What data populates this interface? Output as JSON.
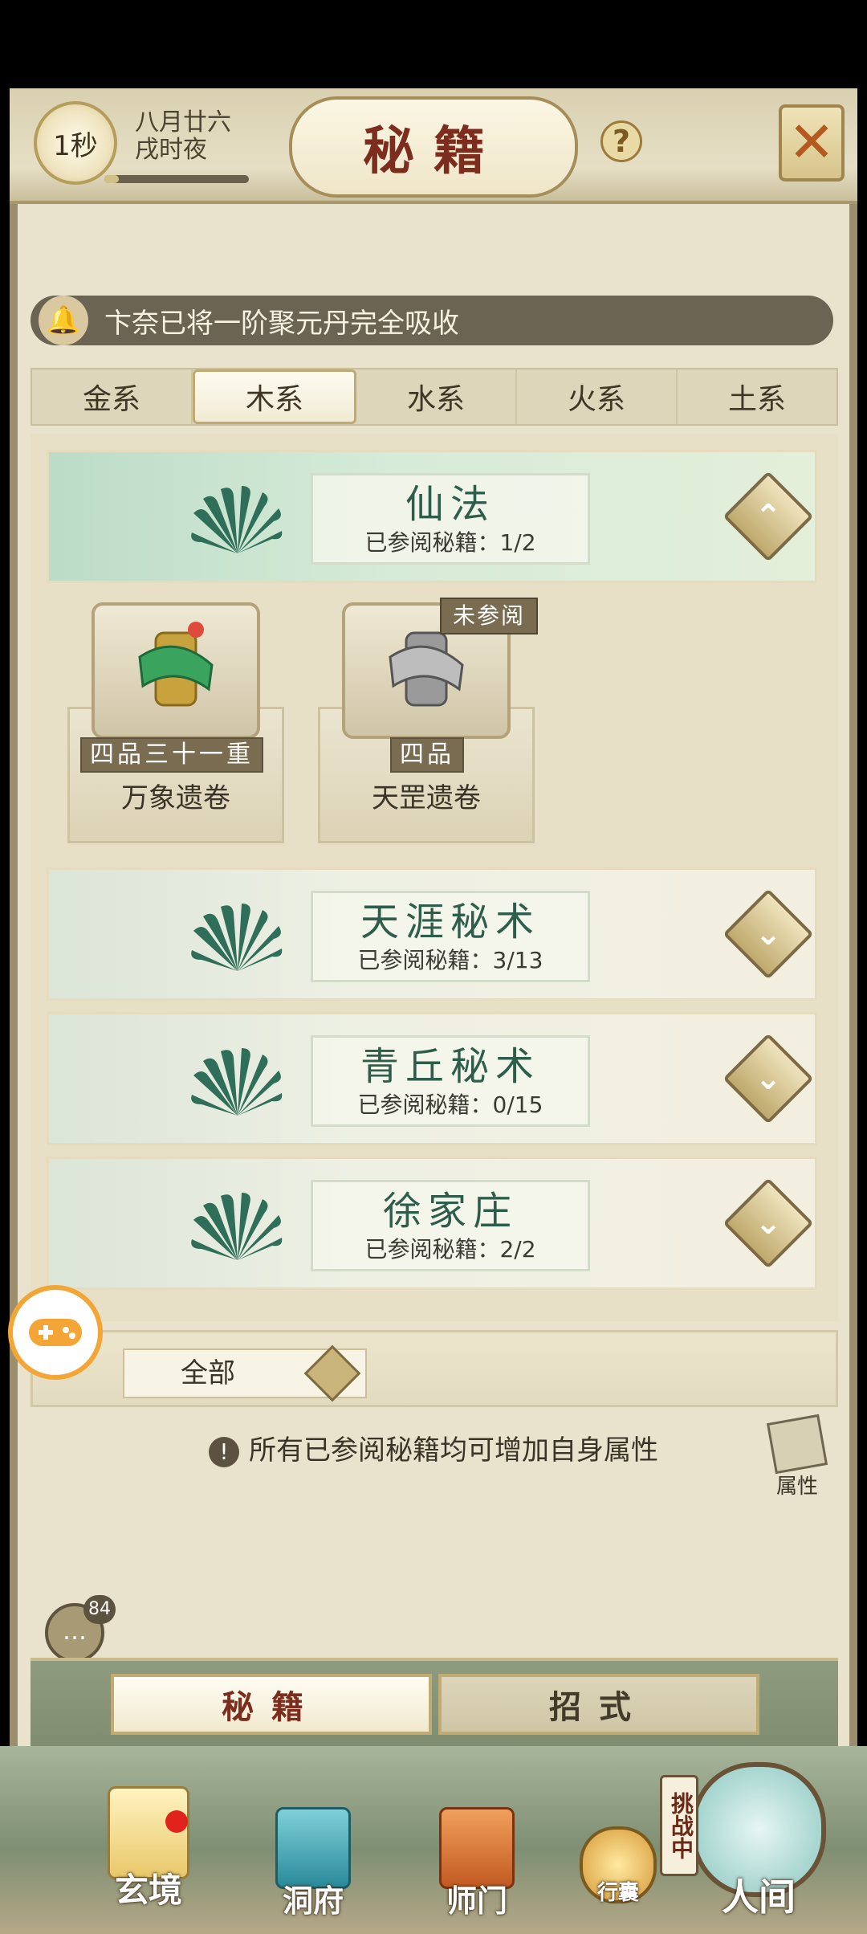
{
  "header": {
    "timer_label": "1秒",
    "date_line1": "八月廿六",
    "date_line2": "戌时夜",
    "progress_fraction": 0.1,
    "title": "秘籍",
    "help_label": "?"
  },
  "notice": {
    "text": "卞奈已将一阶聚元丹完全吸收"
  },
  "element_tabs": [
    {
      "label": "金系"
    },
    {
      "label": "木系"
    },
    {
      "label": "水系"
    },
    {
      "label": "火系"
    },
    {
      "label": "土系"
    }
  ],
  "active_tab_index": 1,
  "categories": [
    {
      "name": "仙法",
      "progress": "已参阅秘籍：1/2",
      "expanded": true
    },
    {
      "name": "天涯秘术",
      "progress": "已参阅秘籍：3/13",
      "expanded": false
    },
    {
      "name": "青丘秘术",
      "progress": "已参阅秘籍：0/15",
      "expanded": false
    },
    {
      "name": "徐家庄",
      "progress": "已参阅秘籍：2/2",
      "expanded": false
    }
  ],
  "books": [
    {
      "grade": "四品三十一重",
      "name": "万象遗卷",
      "status": ""
    },
    {
      "grade": "四品",
      "name": "天罡遗卷",
      "status": "未参阅"
    }
  ],
  "filter": {
    "selected": "全部"
  },
  "hint_text": "所有已参阅秘籍均可增加自身属性",
  "attr_label": "属性",
  "chat_count": "84",
  "subtabs": [
    {
      "label": "秘籍"
    },
    {
      "label": "招式"
    }
  ],
  "nav": [
    {
      "label": "玄境"
    },
    {
      "label": "洞府"
    },
    {
      "label": "师门"
    },
    {
      "label": "行囊"
    },
    {
      "label": "人间"
    }
  ],
  "challenge_label": "挑战中",
  "colors": {
    "accent_red": "#7d2d1e",
    "jade": "#2e5d4c",
    "bronze": "#a68e5b"
  }
}
